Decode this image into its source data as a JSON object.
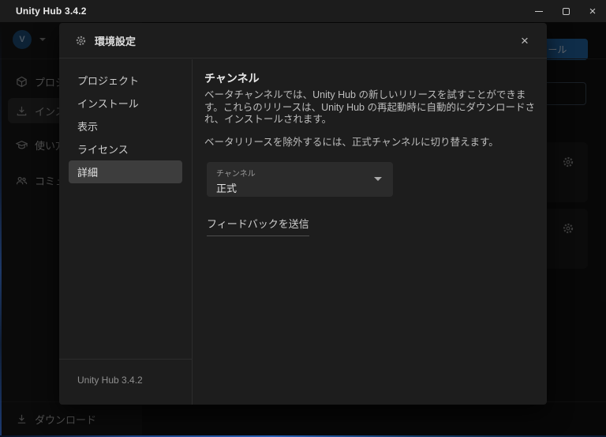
{
  "window": {
    "title": "Unity Hub 3.4.2"
  },
  "icons": {
    "close_glyph": "×",
    "avatar_initial": "V"
  },
  "app": {
    "install_button_label": "インストール",
    "sidebar": {
      "items": [
        {
          "label": "プロジェクト",
          "icon": "cube"
        },
        {
          "label": "インストール",
          "icon": "install-download",
          "selected": true
        },
        {
          "label": "使い方",
          "icon": "graduation-cap"
        },
        {
          "label": "コミュニティ",
          "icon": "people"
        }
      ],
      "downloads_label": "ダウンロード"
    }
  },
  "dialog": {
    "title": "環境設定",
    "nav": [
      {
        "label": "プロジェクト"
      },
      {
        "label": "インストール"
      },
      {
        "label": "表示"
      },
      {
        "label": "ライセンス"
      },
      {
        "label": "詳細",
        "selected": true
      }
    ],
    "version": "Unity Hub 3.4.2",
    "content": {
      "heading": "チャンネル",
      "description": "ベータチャンネルでは、Unity Hub の新しいリリースを試すことができます。これらのリリースは、Unity Hub の再起動時に自動的にダウンロードされ、インストールされます。",
      "note": "ベータリリースを除外するには、正式チャンネルに切り替えます。",
      "dropdown": {
        "label": "チャンネル",
        "value": "正式"
      },
      "feedback_link": "フィードバックを送信"
    }
  },
  "colors": {
    "titlebar_bg": "#1c1c1c",
    "dialog_bg": "#1d1d1d",
    "selected_nav_bg": "#3d3d3d",
    "dropdown_bg": "#2b2b2b",
    "accent_blue": "#2468a6",
    "avatar_blue": "#1f4e79"
  }
}
